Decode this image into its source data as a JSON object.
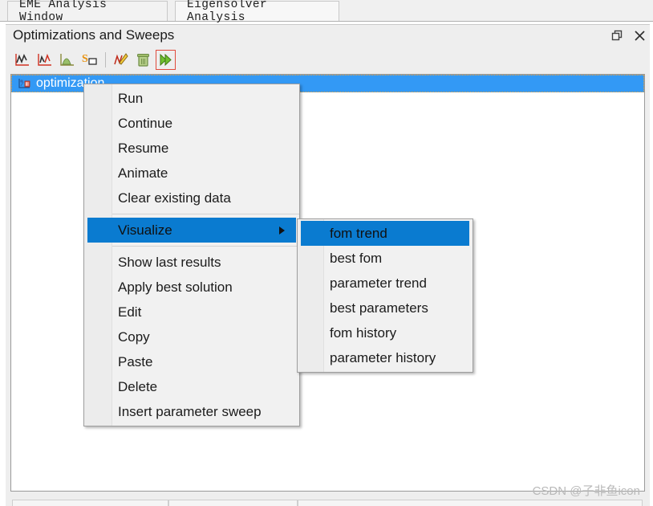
{
  "window": {
    "tabs": [
      {
        "label": "EME Analysis Window",
        "active": false
      },
      {
        "label": "Eigensolver Analysis",
        "active": true
      }
    ]
  },
  "panel": {
    "title": "Optimizations and Sweeps",
    "buttons": [
      {
        "name": "restore-icon",
        "title": "Restore"
      },
      {
        "name": "close-icon",
        "title": "Close"
      }
    ]
  },
  "toolbar": {
    "items": [
      {
        "name": "add-optimization-icon",
        "title": "Optimization"
      },
      {
        "name": "add-sweep-icon",
        "title": "Parameter sweep"
      },
      {
        "name": "add-montecarlo-icon",
        "title": "Monte Carlo analysis"
      },
      {
        "name": "add-smatrix-sweep-icon",
        "title": "S-parameter sweep"
      },
      {
        "name": "edit-icon",
        "title": "Edit"
      },
      {
        "name": "delete-icon",
        "title": "Delete"
      },
      {
        "name": "run-icon",
        "title": "Run"
      }
    ]
  },
  "tree": {
    "items": [
      {
        "label": "optimization",
        "icon": "optimization-icon",
        "selected": true
      }
    ]
  },
  "context_menu": {
    "items": [
      {
        "label": "Run",
        "highlighted": false,
        "submenu": false
      },
      {
        "label": "Continue",
        "highlighted": false,
        "submenu": false
      },
      {
        "label": "Resume",
        "highlighted": false,
        "submenu": false
      },
      {
        "label": "Animate",
        "highlighted": false,
        "submenu": false
      },
      {
        "label": "Clear existing data",
        "highlighted": false,
        "submenu": false
      },
      {
        "label": "Visualize",
        "highlighted": true,
        "submenu": true
      },
      {
        "label": "Show last results",
        "highlighted": false,
        "submenu": false
      },
      {
        "label": "Apply best solution",
        "highlighted": false,
        "submenu": false
      },
      {
        "label": "Edit",
        "highlighted": false,
        "submenu": false
      },
      {
        "label": "Copy",
        "highlighted": false,
        "submenu": false
      },
      {
        "label": "Paste",
        "highlighted": false,
        "submenu": false
      },
      {
        "label": "Delete",
        "highlighted": false,
        "submenu": false
      },
      {
        "label": "Insert parameter sweep",
        "highlighted": false,
        "submenu": false
      }
    ]
  },
  "submenu": {
    "items": [
      {
        "label": "fom trend",
        "highlighted": true
      },
      {
        "label": "best fom",
        "highlighted": false
      },
      {
        "label": "parameter trend",
        "highlighted": false
      },
      {
        "label": "best parameters",
        "highlighted": false
      },
      {
        "label": "fom history",
        "highlighted": false
      },
      {
        "label": "parameter history",
        "highlighted": false
      }
    ]
  },
  "watermark": {
    "text": "CSDN @子非鱼icon"
  },
  "colors": {
    "selection_blue": "#3399f5",
    "menu_highlight_blue": "#0a7bd0",
    "panel_gray": "#eeeeee",
    "menu_gray": "#f1f1f1",
    "accent_red": "#e04b3c"
  }
}
